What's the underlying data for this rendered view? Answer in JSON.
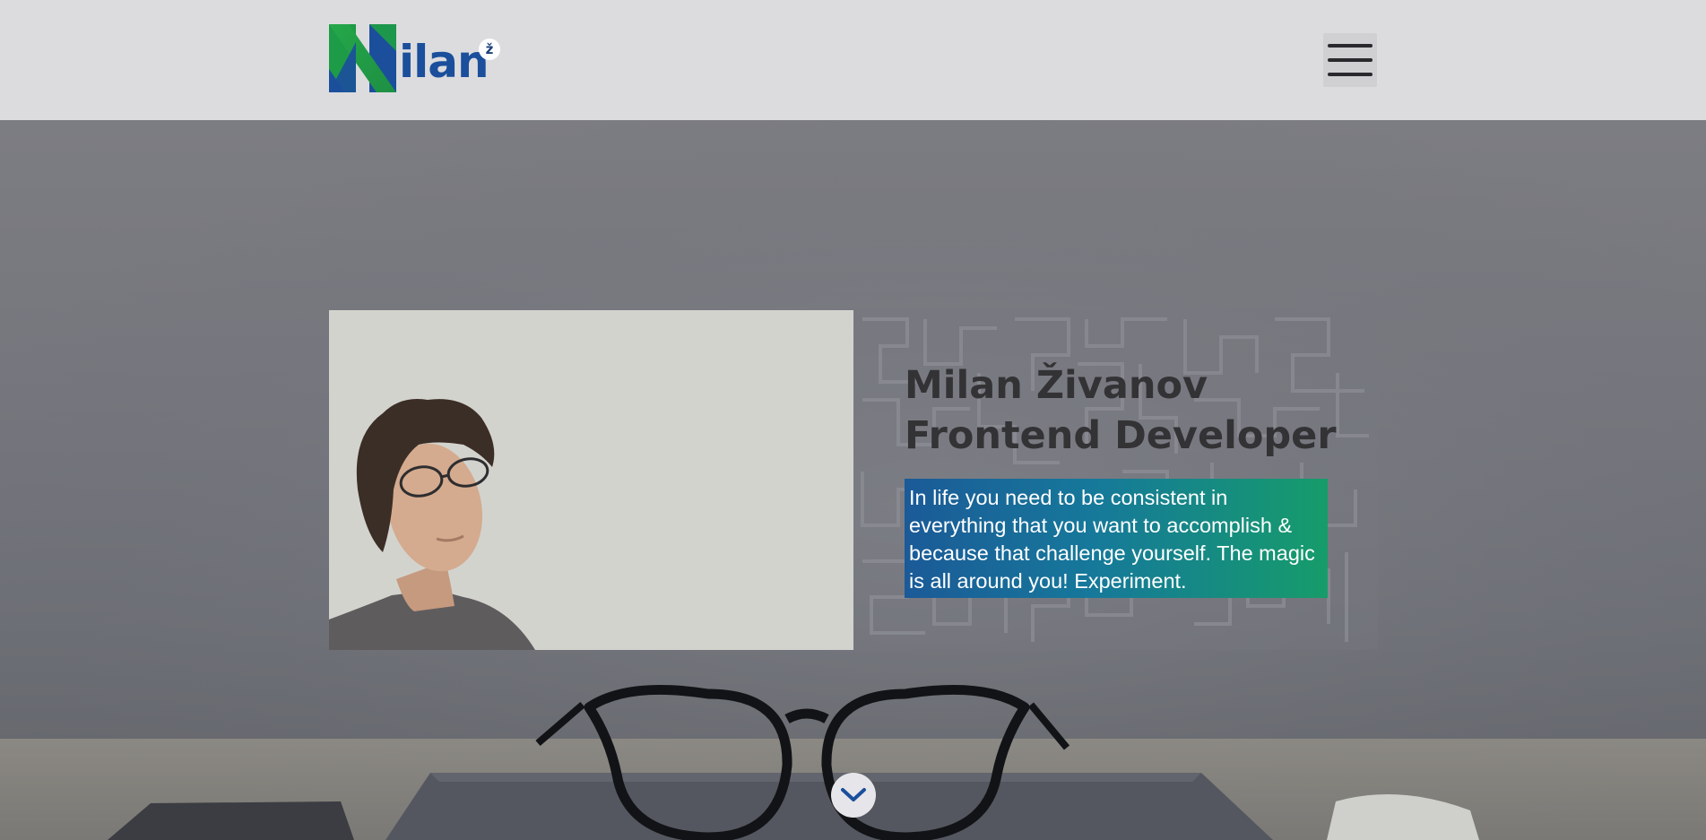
{
  "header": {
    "logo_text": "ilan",
    "logo_badge": "ž",
    "menu_icon": "hamburger-icon"
  },
  "hero": {
    "name_line": "Milan Živanov",
    "role_line": "Frontend Developer",
    "quote": "In life you need to be consistent in everything that you want to accomplish & because that challenge yourself. The magic is all around you! Experiment.",
    "scroll_icon": "chevron-down-icon"
  },
  "colors": {
    "header_bg": "#dcdcde",
    "logo_blue": "#1b4f9c",
    "logo_green": "#1f9e4a",
    "quote_gradient_start": "#1b5a98",
    "quote_gradient_end": "#169c6a",
    "title_color": "#333336"
  }
}
